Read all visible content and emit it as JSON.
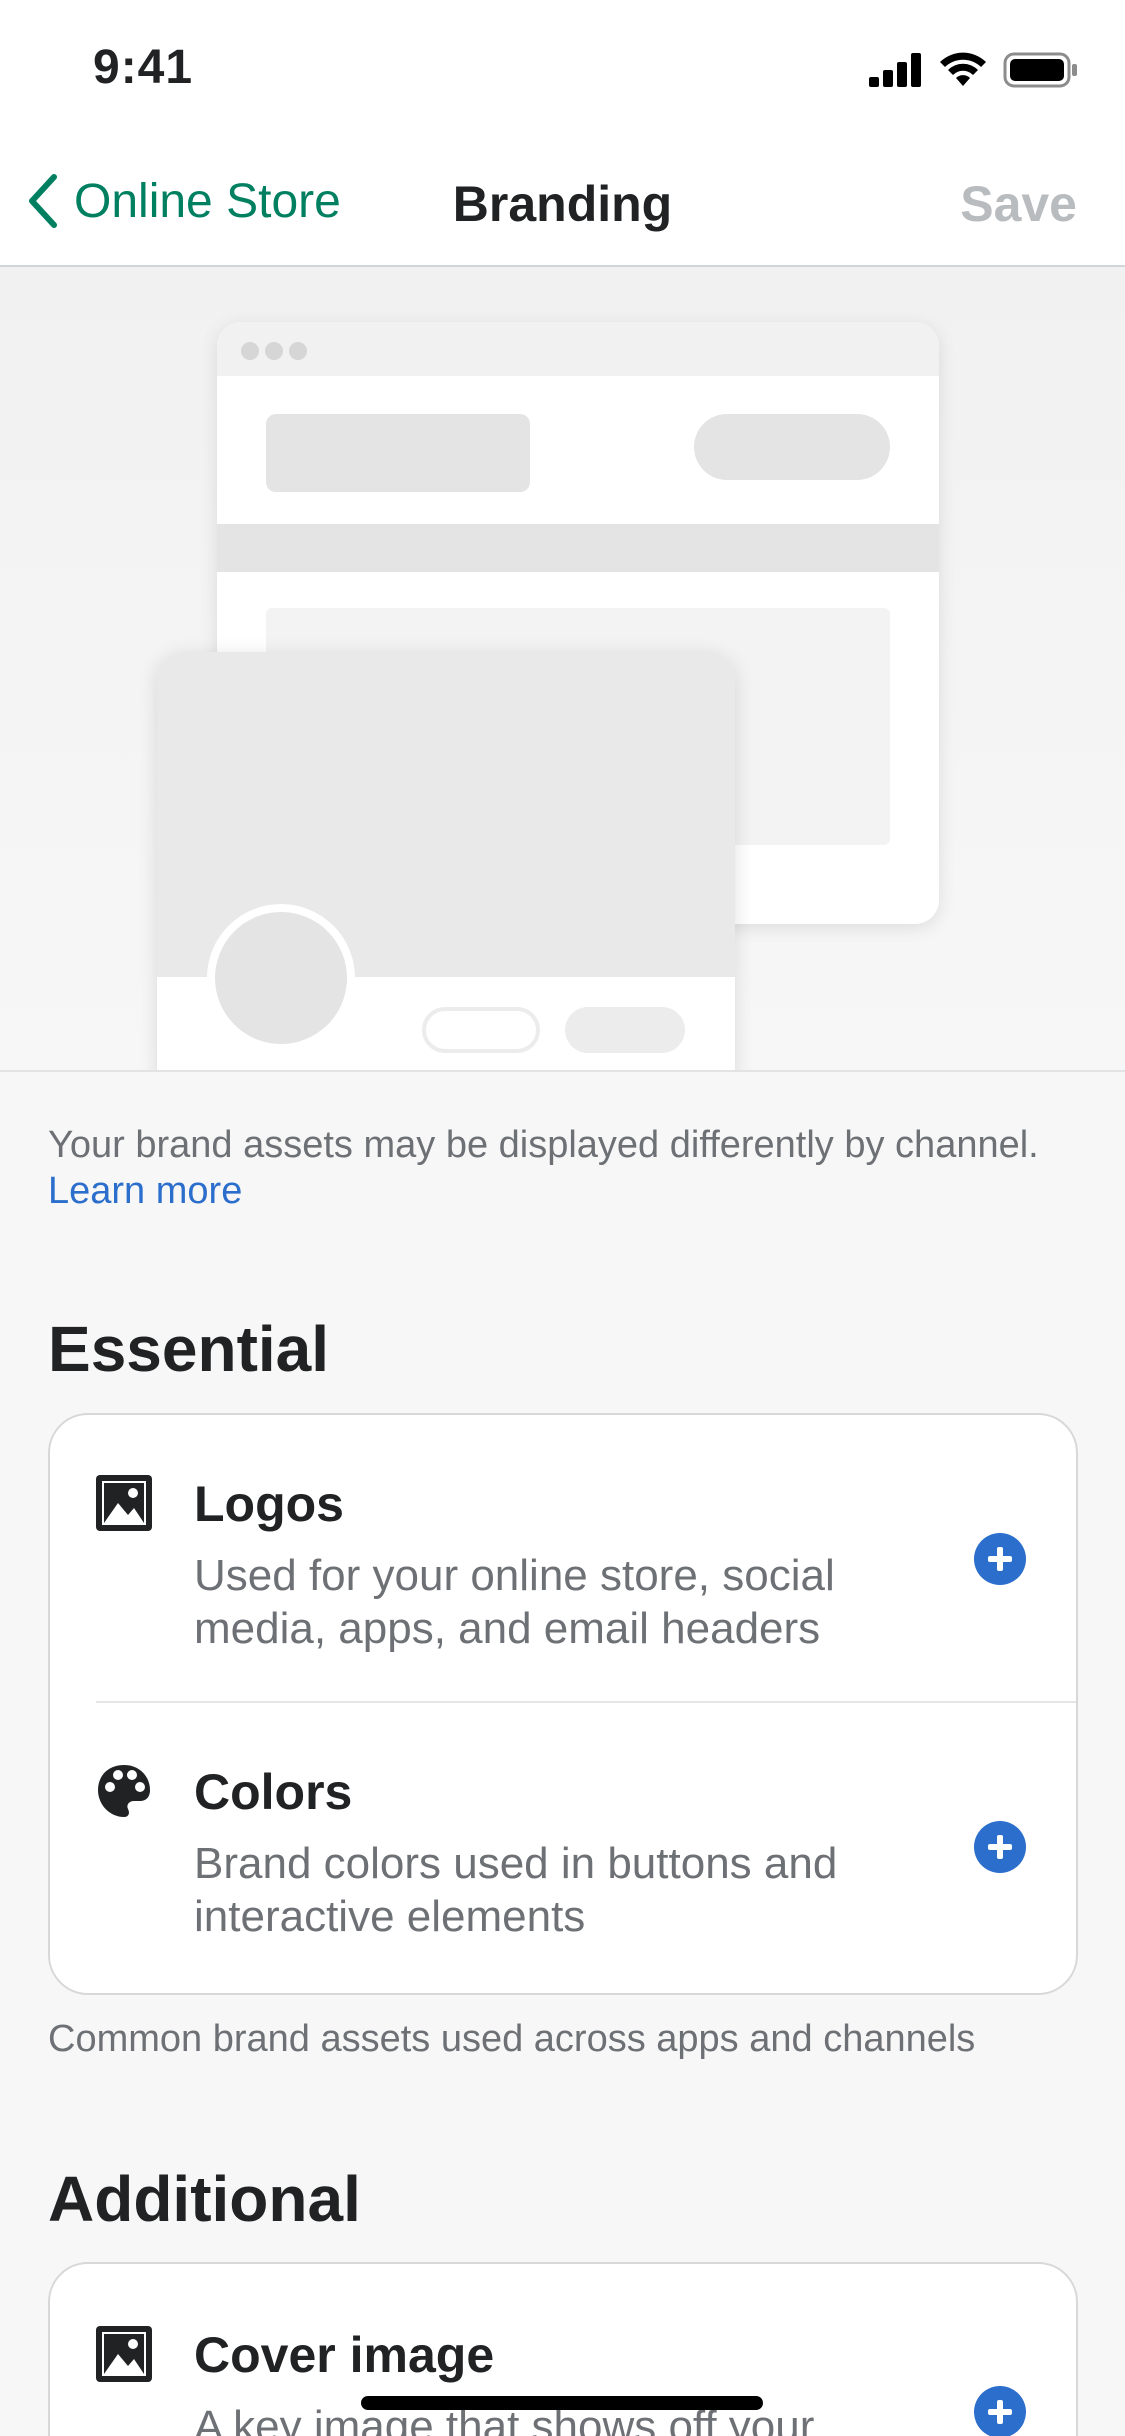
{
  "status_bar": {
    "time": "9:41"
  },
  "nav": {
    "back_label": "Online Store",
    "title": "Branding",
    "save_label": "Save"
  },
  "intro": {
    "text": "Your brand assets may be displayed differently by channel.",
    "link": "Learn more"
  },
  "sections": {
    "essential": {
      "heading": "Essential",
      "footnote": "Common brand assets used across apps and channels",
      "items": [
        {
          "title": "Logos",
          "description": "Used for your online store, social media, apps, and email headers",
          "icon": "image-icon"
        },
        {
          "title": "Colors",
          "description": "Brand colors used in buttons and interactive elements",
          "icon": "palette-icon"
        }
      ]
    },
    "additional": {
      "heading": "Additional",
      "items": [
        {
          "title": "Cover image",
          "description": "A key image that shows off your",
          "icon": "image-icon"
        }
      ]
    }
  },
  "colors": {
    "accent_green": "#008060",
    "link_blue": "#2c6ecb",
    "disabled_gray": "#b9bcbf"
  }
}
